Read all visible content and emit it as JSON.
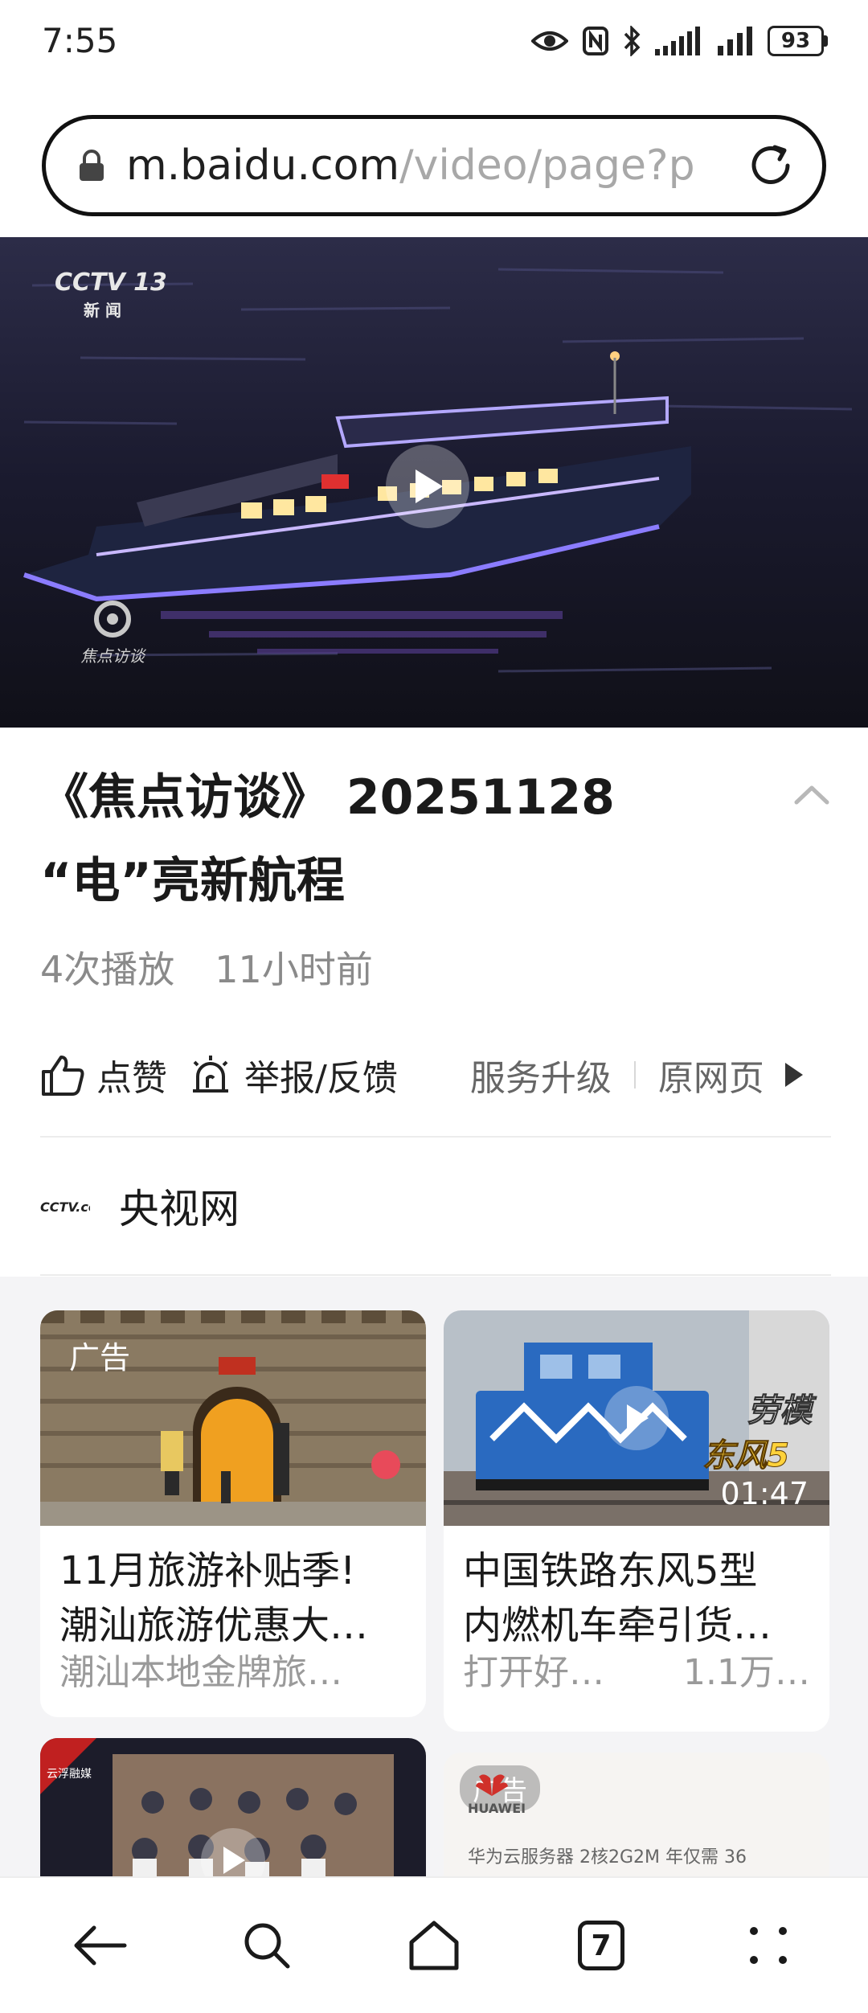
{
  "status_bar": {
    "time": "7:55",
    "battery": "93"
  },
  "address_bar": {
    "url_host": "m.baidu.com",
    "url_path": "/video/page?p"
  },
  "video": {
    "channel_logo_text": "CCTV 13",
    "channel_logo_sub": "新 闻",
    "program_logo_text": "焦点访谈"
  },
  "title": "《焦点访谈》 20251128 “电”亮新航程",
  "meta": {
    "plays": "4次播放",
    "time_ago": "11小时前"
  },
  "actions": {
    "like": "点赞",
    "report": "举报/反馈",
    "upgrade": "服务升级",
    "original": "原网页"
  },
  "channel": {
    "name": "央视网",
    "logo_text": "CCTV.com"
  },
  "cards": [
    {
      "ad_tag": "广告",
      "title_line1": "11月旅游补贴季!",
      "title_line2": "潮汕旅游优惠大…",
      "meta_left": "潮汕本地金牌旅…",
      "meta_right": ""
    },
    {
      "title_line1": "中国铁路东风5型",
      "title_line2": "内燃机车牵引货…",
      "meta_left": "打开好…",
      "meta_right": "1.1万…",
      "duration": "01:47",
      "overlay_top": "劳模",
      "overlay_bottom": "东风5"
    },
    {
      "logo_text": "云浮融媒"
    },
    {
      "ad_tag": "广告",
      "brand": "HUAWEI",
      "headline": "华为云服务器 2核2G2M 年仅需 36"
    }
  ],
  "bottom_nav": {
    "tabs_count": "7"
  }
}
